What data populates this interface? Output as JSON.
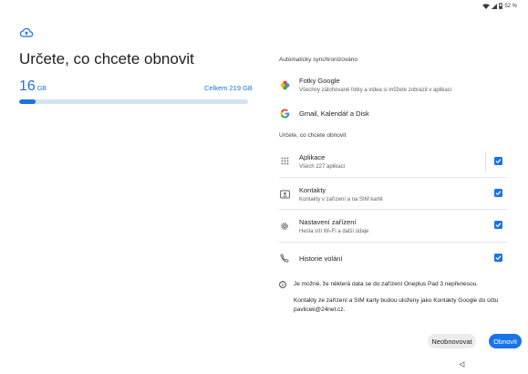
{
  "status_bar": {
    "battery": "52 %"
  },
  "header": {
    "title": "Určete, co chcete obnovit"
  },
  "storage": {
    "used_value": "16",
    "used_unit": "GB",
    "total_label": "Celkem 219 GB",
    "fill_fraction": 0.073
  },
  "sync_section": {
    "title": "Automaticky synchronizováno",
    "items": [
      {
        "title": "Fotky Google",
        "subtitle": "Všechny zálohované fotky a videa si můžete zobrazit v aplikaci",
        "icon": "google-photos-icon"
      },
      {
        "title": "Gmail, Kalendář a Disk",
        "icon": "google-icon"
      }
    ]
  },
  "restore_section": {
    "title": "Určete, co chcete obnovit",
    "items": [
      {
        "title": "Aplikace",
        "subtitle": "Všech 227 aplikací",
        "icon": "apps-grid-icon",
        "checked": true
      },
      {
        "title": "Kontakty",
        "subtitle": "Kontakty v zařízení a na SIM kartě",
        "icon": "contacts-icon",
        "checked": true
      },
      {
        "title": "Nastavení zařízení",
        "subtitle": "Hesla sítí Wi-Fi a další údaje",
        "icon": "settings-gear-icon",
        "checked": true
      },
      {
        "title": "Historie volání",
        "icon": "phone-icon",
        "checked": true
      }
    ]
  },
  "info": {
    "line1": "Je možné, že některá data se do zařízení Oneplus Pad 3 nepřenesou.",
    "line2a": "Kontakty ze zařízení a SIM karty budou uloženy jako Kontakty Google do účtu",
    "line2b": "pavlicek@24net.cz."
  },
  "buttons": {
    "secondary": "Neobnovovat",
    "primary": "Obnovit"
  },
  "colors": {
    "accent": "#1a73e8",
    "track": "#d5e3f5"
  }
}
